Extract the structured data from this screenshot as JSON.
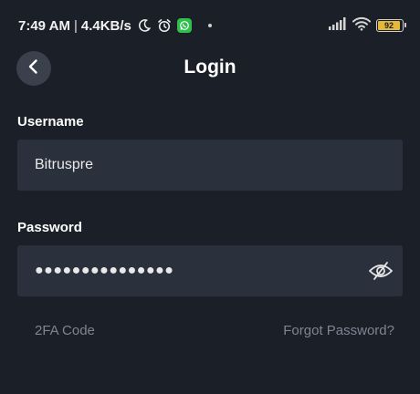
{
  "status_bar": {
    "time": "7:49 AM",
    "separator": "|",
    "net_speed": "4.4KB/s",
    "battery_level": "92",
    "battery_fill_fraction": 0.92,
    "icons": [
      "moon-icon",
      "alarm-clock-icon",
      "whatsapp-icon",
      "notification-dot-icon",
      "signal-icon",
      "wifi-icon",
      "battery-icon"
    ]
  },
  "header": {
    "title": "Login",
    "back_icon": "chevron-left-icon"
  },
  "form": {
    "username": {
      "label": "Username",
      "value": "Bitruspre"
    },
    "password": {
      "label": "Password",
      "value": "●●●●●●●●●●●●●●●",
      "toggle_icon": "eye-slash-icon"
    }
  },
  "links": {
    "twofa": "2FA Code",
    "forgot": "Forgot Password?"
  },
  "colors": {
    "background": "#1b1f27",
    "field_bg": "#2b313c",
    "back_button_bg": "#3b414c",
    "link_text": "#7d8593",
    "battery": "#e6b83a",
    "whatsapp": "#2fbf4a"
  }
}
